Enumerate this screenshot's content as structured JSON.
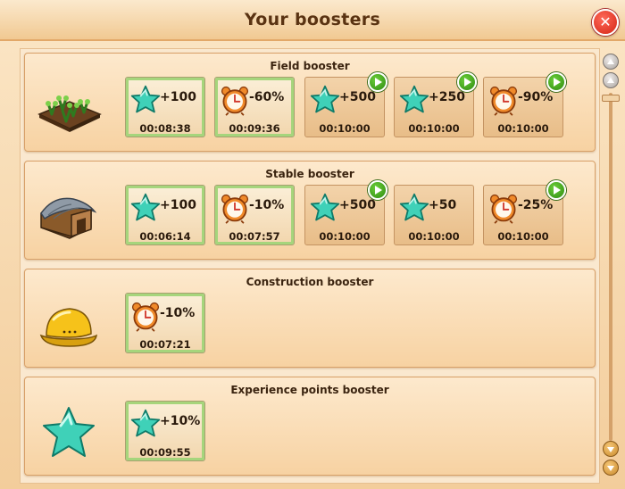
{
  "window": {
    "title": "Your boosters"
  },
  "panels": [
    {
      "title": "Field booster",
      "icon": "field-icon",
      "slots": [
        {
          "type": "star",
          "value": "+100",
          "time": "00:08:38",
          "active": true,
          "play": false
        },
        {
          "type": "clock",
          "value": "-60%",
          "time": "00:09:36",
          "active": true,
          "play": false
        },
        {
          "type": "star",
          "value": "+500",
          "time": "00:10:00",
          "active": false,
          "play": true
        },
        {
          "type": "star",
          "value": "+250",
          "time": "00:10:00",
          "active": false,
          "play": true
        },
        {
          "type": "clock",
          "value": "-90%",
          "time": "00:10:00",
          "active": false,
          "play": true
        }
      ]
    },
    {
      "title": "Stable booster",
      "icon": "stable-icon",
      "slots": [
        {
          "type": "star",
          "value": "+100",
          "time": "00:06:14",
          "active": true,
          "play": false
        },
        {
          "type": "clock",
          "value": "-10%",
          "time": "00:07:57",
          "active": true,
          "play": false
        },
        {
          "type": "star",
          "value": "+500",
          "time": "00:10:00",
          "active": false,
          "play": true
        },
        {
          "type": "star",
          "value": "+50",
          "time": "00:10:00",
          "active": false,
          "play": false
        },
        {
          "type": "clock",
          "value": "-25%",
          "time": "00:10:00",
          "active": false,
          "play": true
        }
      ]
    },
    {
      "title": "Construction booster",
      "icon": "helmet-icon",
      "slots": [
        {
          "type": "clock",
          "value": "-10%",
          "time": "00:07:21",
          "active": true,
          "play": false
        }
      ]
    },
    {
      "title": "Experience points booster",
      "icon": "star-icon",
      "slots": [
        {
          "type": "star",
          "value": "+10%",
          "time": "00:09:55",
          "active": true,
          "play": false
        }
      ]
    }
  ],
  "colors": {
    "accent_green": "#a6d57c",
    "close_red": "#d32414",
    "play_green": "#2e8a10",
    "star_teal": "#3fd1b8",
    "clock_orange": "#f08a2a"
  }
}
